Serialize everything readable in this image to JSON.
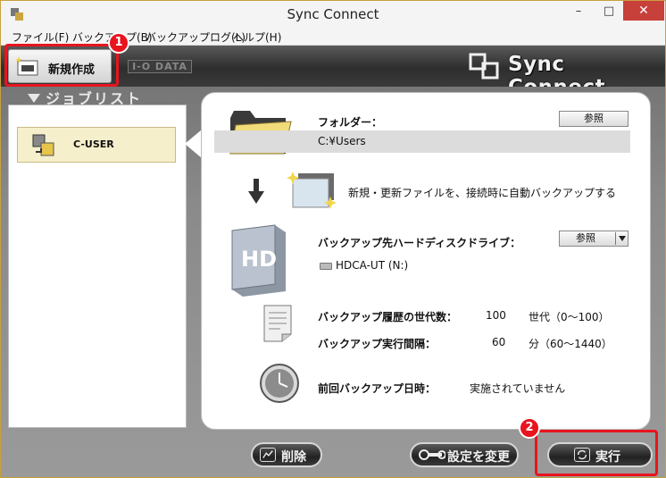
{
  "window": {
    "title": "Sync Connect",
    "minimize": "–",
    "maximize": "□",
    "close": "✕"
  },
  "menu": [
    {
      "label": "ファイル(F)"
    },
    {
      "label": "バックアップ(B)"
    },
    {
      "label": "バックアップログ(L)"
    },
    {
      "label": "ヘルプ(H)"
    }
  ],
  "toolbar": {
    "new_label": "新規作成",
    "iodata": "I-O DATA",
    "brand": "Sync Connect"
  },
  "joblist": {
    "heading": "ジョブリスト",
    "items": [
      {
        "label": "C-USER"
      }
    ]
  },
  "detail": {
    "folder_label": "フォルダー：",
    "browse_label": "参照",
    "folder_path": "C:¥Users",
    "sync_desc": "新規・更新ファイルを、接続時に自動バックアップする",
    "hd_label": "バックアップ先ハードディスクドライブ：",
    "hd_browse_label": "参照",
    "drive_name": "HDCA-UT (N:)",
    "generations_label": "バックアップ履歴の世代数：",
    "generations_value": "100",
    "generations_unit": "世代（0～100）",
    "interval_label": "バックアップ実行間隔：",
    "interval_value": "60",
    "interval_unit": "分（60～1440）",
    "last_label": "前回バックアップ日時：",
    "last_value": "実施されていません"
  },
  "actions": {
    "delete_label": "削除",
    "settings_label": "設定を変更",
    "run_label": "実行"
  },
  "annotations": {
    "badge1": "1",
    "badge2": "2"
  },
  "colors": {
    "highlight": "#e8141e",
    "job_selected": "#f6efcc",
    "close_button": "#c7403a"
  }
}
